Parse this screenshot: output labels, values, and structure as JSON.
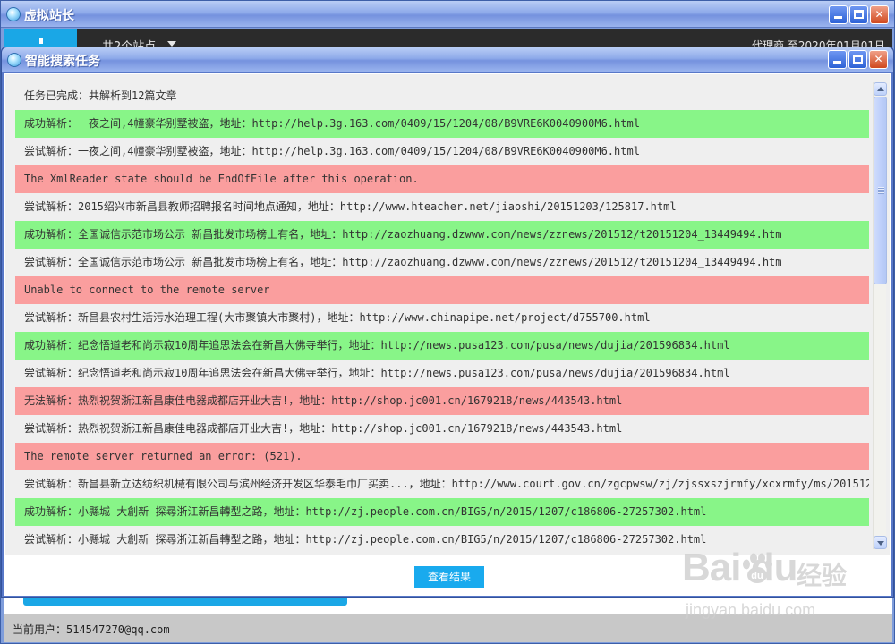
{
  "main_window": {
    "title": "虚拟站长",
    "header": {
      "sites_label": "共2个站点",
      "agent_text": "代理商   至2020年01月01日"
    },
    "status_bar": {
      "user_label": "当前用户：514547270@qq.com"
    }
  },
  "dialog": {
    "title": "智能搜索任务",
    "log_rows": [
      {
        "status": "normal",
        "text": "任务已完成：共解析到12篇文章"
      },
      {
        "status": "success",
        "text": "成功解析：一夜之间,4幢豪华别墅被盗，地址：http://help.3g.163.com/0409/15/1204/08/B9VRE6K0040900M6.html"
      },
      {
        "status": "normal",
        "text": "尝试解析：一夜之间,4幢豪华别墅被盗，地址：http://help.3g.163.com/0409/15/1204/08/B9VRE6K0040900M6.html"
      },
      {
        "status": "error",
        "text": "The XmlReader state should be EndOfFile after this operation."
      },
      {
        "status": "normal",
        "text": "尝试解析：2015绍兴市新昌县教师招聘报名时间地点通知，地址：http://www.hteacher.net/jiaoshi/20151203/125817.html"
      },
      {
        "status": "success",
        "text": "成功解析：全国诚信示范市场公示 新昌批发市场榜上有名，地址：http://zaozhuang.dzwww.com/news/zznews/201512/t20151204_13449494.htm"
      },
      {
        "status": "normal",
        "text": "尝试解析：全国诚信示范市场公示 新昌批发市场榜上有名，地址：http://zaozhuang.dzwww.com/news/zznews/201512/t20151204_13449494.htm"
      },
      {
        "status": "error",
        "text": "Unable to connect to the remote server"
      },
      {
        "status": "normal",
        "text": "尝试解析：新昌县农村生活污水治理工程(大市聚镇大市聚村)，地址：http://www.chinapipe.net/project/d755700.html"
      },
      {
        "status": "success",
        "text": "成功解析：纪念悟道老和尚示寂10周年追思法会在新昌大佛寺举行，地址：http://news.pusa123.com/pusa/news/dujia/201596834.html"
      },
      {
        "status": "normal",
        "text": "尝试解析：纪念悟道老和尚示寂10周年追思法会在新昌大佛寺举行，地址：http://news.pusa123.com/pusa/news/dujia/201596834.html"
      },
      {
        "status": "error",
        "text": "无法解析：热烈祝贺浙江新昌康佳电器成都店开业大吉!，地址：http://shop.jc001.cn/1679218/news/443543.html"
      },
      {
        "status": "normal",
        "text": "尝试解析：热烈祝贺浙江新昌康佳电器成都店开业大吉!，地址：http://shop.jc001.cn/1679218/news/443543.html"
      },
      {
        "status": "error",
        "text": "The remote server returned an error: (521)."
      },
      {
        "status": "normal",
        "text": "尝试解析：新昌县新立达纺织机械有限公司与滨州经济开发区华泰毛巾厂买卖...，地址：http://www.court.gov.cn/zgcpwsw/zj/zjssxszjrmfy/xcxrmfy/ms/201512"
      },
      {
        "status": "success",
        "text": "成功解析：小縣城 大創新 探尋浙江新昌轉型之路，地址：http://zj.people.com.cn/BIG5/n/2015/1207/c186806-27257302.html"
      },
      {
        "status": "normal",
        "text": "尝试解析：小縣城 大創新 探尋浙江新昌轉型之路，地址：http://zj.people.com.cn/BIG5/n/2015/1207/c186806-27257302.html"
      }
    ],
    "result_button_label": "查看结果"
  },
  "watermark": {
    "brand": "Bai  du",
    "chinese": "经验",
    "url": "jingyan.baidu.com"
  },
  "colors": {
    "success_row": "#88f588",
    "error_row": "#fa9e9e",
    "accent_blue": "#19aaee"
  }
}
